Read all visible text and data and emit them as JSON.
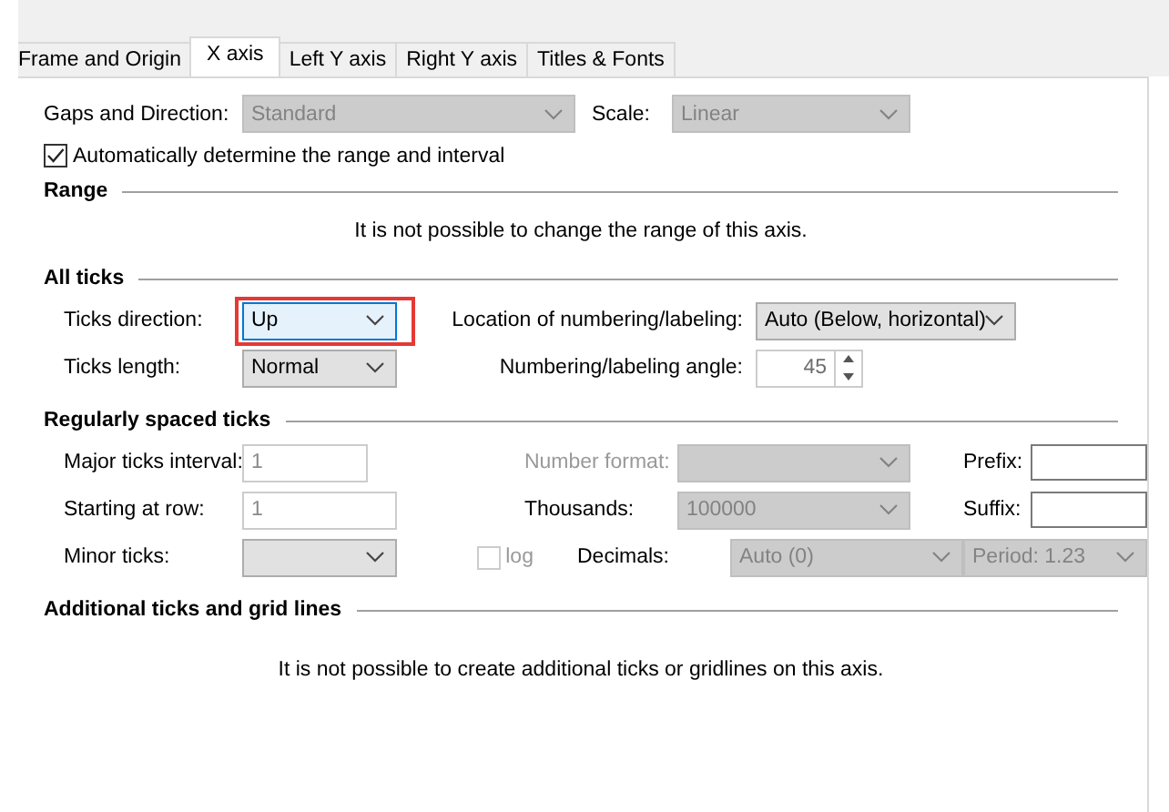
{
  "tabs": [
    {
      "label": "Frame and Origin",
      "selected": false
    },
    {
      "label": "X axis",
      "selected": true
    },
    {
      "label": "Left Y axis",
      "selected": false
    },
    {
      "label": "Right Y axis",
      "selected": false
    },
    {
      "label": "Titles & Fonts",
      "selected": false
    }
  ],
  "top_row": {
    "main": {
      "kind": "dropdown",
      "label": "Gaps and Direction:",
      "value": "Standard",
      "disabled": true
    },
    "side": {
      "kind": "dropdown",
      "label": "Scale:",
      "value": "Linear",
      "disabled": true
    }
  },
  "auto_range": {
    "kind": "checkbox",
    "label": "Automatically determine the range and interval",
    "checked": true,
    "disabled": false
  },
  "sections": [
    {
      "heading": "Range",
      "note": "It is not possible to change the range of this axis."
    },
    {
      "heading": "All ticks",
      "rows": [
        {
          "main": {
            "kind": "dropdown",
            "label": "Ticks direction:",
            "value": "Up",
            "disabled": false,
            "focused": true,
            "highlighted": true
          },
          "labeling": {
            "kind": "dropdown",
            "label": "Location of numbering/labeling:",
            "value": "Auto (Below, horizontal)",
            "disabled": false
          }
        },
        {
          "main": {
            "kind": "dropdown",
            "label": "Ticks length:",
            "value": "Normal",
            "disabled": false
          },
          "labeling": {
            "kind": "spinner",
            "label": "Numbering/labeling angle:",
            "value": "45",
            "disabled": true
          }
        }
      ]
    },
    {
      "heading": "Regularly spaced ticks",
      "rows": [
        {
          "main": {
            "kind": "text",
            "label": "Major ticks interval:",
            "value": "1",
            "disabled": true
          },
          "format": {
            "kind": "dropdown",
            "label": "Number format:",
            "label_disabled": true,
            "disabled": true
          },
          "affix": {
            "kind": "text",
            "label": "Prefix:",
            "disabled": false
          }
        },
        {
          "main": {
            "kind": "text",
            "label": "Starting at row:",
            "value": "1",
            "disabled": true
          },
          "format": {
            "kind": "dropdown",
            "label": "Thousands:",
            "value": "100000",
            "disabled": true
          },
          "affix": {
            "kind": "text",
            "label": "Suffix:",
            "disabled": false
          }
        },
        {
          "main": {
            "kind": "dropdown",
            "label": "Minor ticks:",
            "disabled": false
          },
          "option": {
            "kind": "checkbox",
            "label": "log",
            "checked": false,
            "disabled": true
          },
          "format": {
            "kind": "dropdown",
            "label": "Decimals:",
            "value": "Auto (0)",
            "disabled": true
          },
          "affix": {
            "kind": "dropdown",
            "value": "Period: 1.23",
            "disabled": true
          }
        }
      ]
    },
    {
      "heading": "Additional ticks and grid lines",
      "note": "It is not possible to create additional ticks or gridlines on this axis."
    }
  ]
}
